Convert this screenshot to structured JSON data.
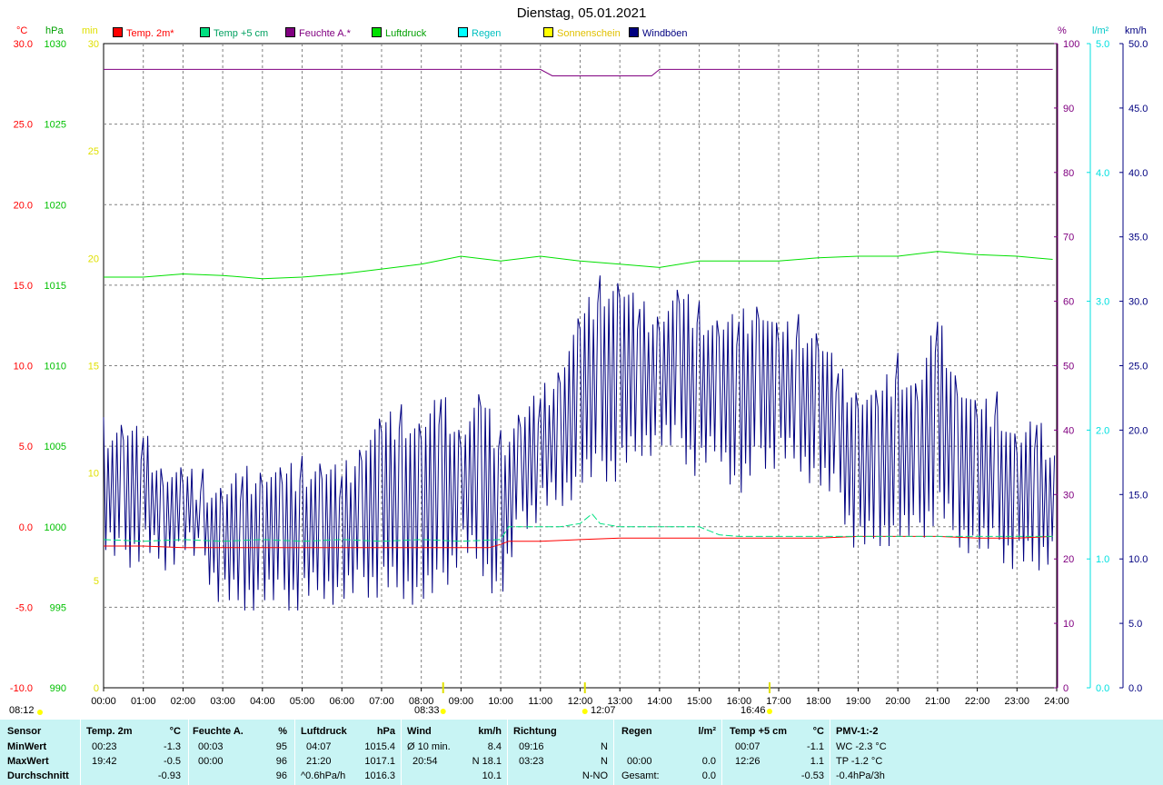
{
  "title": "Dienstag, 05.01.2021",
  "legend": [
    {
      "label": "Temp. 2m*",
      "color": "#ff0000",
      "text_color": "#ff0000"
    },
    {
      "label": "Temp +5 cm",
      "color": "#00e080",
      "text_color": "#00a060"
    },
    {
      "label": "Feuchte A.*",
      "color": "#800080",
      "text_color": "#800080"
    },
    {
      "label": "Luftdruck",
      "color": "#00e000",
      "text_color": "#00a000"
    },
    {
      "label": "Regen",
      "color": "#00ffff",
      "text_color": "#00c0c0"
    },
    {
      "label": "Sonnenschein",
      "color": "#ffff00",
      "text_color": "#e0c000"
    },
    {
      "label": "Windböen",
      "color": "#000080",
      "text_color": "#000080"
    }
  ],
  "units": {
    "temp": "°C",
    "pressure": "hPa",
    "sun": "min",
    "humidity": "%",
    "rain": "l/m²",
    "wind": "km/h"
  },
  "chart_data": {
    "type": "line",
    "x_ticks": [
      "00:00",
      "01:00",
      "02:00",
      "03:00",
      "04:00",
      "05:00",
      "06:00",
      "07:00",
      "08:00",
      "09:00",
      "10:00",
      "11:00",
      "12:00",
      "13:00",
      "14:00",
      "15:00",
      "16:00",
      "17:00",
      "18:00",
      "19:00",
      "20:00",
      "21:00",
      "22:00",
      "23:00",
      "24:00"
    ],
    "axes": {
      "temp": {
        "ticks": [
          "30.0",
          "25.0",
          "20.0",
          "15.0",
          "10.0",
          "5.0",
          "0.0",
          "-5.0",
          "-10.0"
        ],
        "range": [
          -10,
          30
        ],
        "color": "#ff0000"
      },
      "pressure": {
        "ticks": [
          "1030",
          "1025",
          "1020",
          "1015",
          "1010",
          "1005",
          "1000",
          "995",
          "990"
        ],
        "range": [
          990,
          1030
        ],
        "color": "#00c000"
      },
      "sun": {
        "ticks": [
          "30",
          "25",
          "20",
          "15",
          "10",
          "5",
          "0"
        ],
        "range": [
          0,
          30
        ],
        "color": "#e0e000"
      },
      "humidity": {
        "ticks": [
          "100",
          "90",
          "80",
          "70",
          "60",
          "50",
          "40",
          "30",
          "20",
          "10",
          "0"
        ],
        "range": [
          0,
          100
        ],
        "color": "#800080"
      },
      "rain": {
        "ticks": [
          "5.0",
          "4.0",
          "3.0",
          "2.0",
          "1.0",
          "0.0"
        ],
        "range": [
          0,
          5
        ],
        "color": "#00e0e0"
      },
      "wind": {
        "ticks": [
          "50.0",
          "45.0",
          "40.0",
          "35.0",
          "30.0",
          "25.0",
          "20.0",
          "15.0",
          "10.0",
          "5.0",
          "0.0"
        ],
        "range": [
          0,
          50
        ],
        "color": "#000080"
      }
    },
    "series": [
      {
        "name": "Temp. 2m*",
        "axis": "temp",
        "color": "#ff0000",
        "x": [
          0,
          1,
          2,
          3,
          4,
          5,
          6,
          7,
          8,
          9,
          9.7,
          10,
          10.2,
          11,
          12,
          13,
          14,
          15,
          16,
          17,
          18,
          19,
          20,
          21,
          22,
          23,
          23.9
        ],
        "y": [
          -1.2,
          -1.2,
          -1.3,
          -1.3,
          -1.3,
          -1.3,
          -1.3,
          -1.3,
          -1.3,
          -1.3,
          -1.3,
          -1.1,
          -0.9,
          -0.9,
          -0.8,
          -0.7,
          -0.7,
          -0.7,
          -0.7,
          -0.7,
          -0.7,
          -0.6,
          -0.6,
          -0.6,
          -0.7,
          -0.7,
          -0.6
        ]
      },
      {
        "name": "Temp +5 cm",
        "axis": "temp",
        "color": "#00e080",
        "x": [
          0,
          1,
          2,
          3,
          4,
          5,
          6,
          7,
          8,
          9,
          10,
          10.2,
          11,
          11.5,
          12,
          12.3,
          12.5,
          13,
          14,
          15,
          15.5,
          16,
          17,
          18,
          19,
          20,
          21,
          22,
          23,
          23.9
        ],
        "y": [
          -0.8,
          -0.9,
          -0.8,
          -0.9,
          -0.8,
          -0.9,
          -0.8,
          -0.9,
          -0.8,
          -0.9,
          -0.8,
          0.0,
          0.0,
          0.0,
          0.2,
          0.8,
          0.2,
          0.0,
          0.0,
          0.0,
          -0.5,
          -0.6,
          -0.6,
          -0.6,
          -0.6,
          -0.6,
          -0.6,
          -0.6,
          -0.6,
          -0.6
        ]
      },
      {
        "name": "Feuchte A.*",
        "axis": "humidity",
        "color": "#800080",
        "x": [
          0,
          0.2,
          1,
          2,
          4,
          6,
          8,
          10,
          11,
          11.3,
          12,
          13,
          13.8,
          14,
          14.5,
          15,
          15.5,
          16,
          18,
          20,
          22,
          23.9
        ],
        "y": [
          96,
          96,
          96,
          96,
          96,
          96,
          96,
          96,
          96,
          95,
          95,
          95,
          95,
          96,
          96,
          96,
          96,
          96,
          96,
          96,
          96,
          96
        ]
      },
      {
        "name": "Luftdruck",
        "axis": "pressure",
        "color": "#00e000",
        "x": [
          0,
          1,
          2,
          3,
          4,
          5,
          6,
          7,
          8,
          9,
          10,
          11,
          12,
          13,
          14,
          15,
          16,
          17,
          18,
          19,
          20,
          21,
          22,
          23,
          23.9
        ],
        "y": [
          1015.5,
          1015.5,
          1015.7,
          1015.6,
          1015.4,
          1015.5,
          1015.7,
          1016.0,
          1016.3,
          1016.8,
          1016.5,
          1016.8,
          1016.5,
          1016.3,
          1016.1,
          1016.5,
          1016.5,
          1016.5,
          1016.7,
          1016.8,
          1016.8,
          1017.1,
          1016.9,
          1016.8,
          1016.6
        ]
      },
      {
        "name": "Windböen",
        "axis": "wind",
        "color": "#000080",
        "x": [
          0,
          0.5,
          1,
          1.5,
          2,
          2.5,
          3,
          3.5,
          4,
          4.5,
          5,
          5.5,
          6,
          6.5,
          7,
          7.5,
          8,
          8.5,
          9,
          9.5,
          10,
          10.5,
          11,
          11.5,
          12,
          12.5,
          13,
          13.5,
          14,
          14.5,
          15,
          15.5,
          16,
          16.5,
          17,
          17.5,
          18,
          18.5,
          19,
          19.5,
          20,
          20.5,
          21,
          21.5,
          22,
          22.5,
          23,
          23.5,
          24
        ],
        "y": [
          16,
          12,
          15,
          11,
          13,
          12,
          9,
          11,
          10,
          12,
          10,
          11,
          10,
          12,
          13,
          14,
          15,
          16,
          15,
          14,
          13,
          17,
          20,
          22,
          22,
          25,
          26,
          25,
          24,
          25,
          23,
          24,
          22,
          25,
          23,
          24,
          21,
          20,
          16,
          17,
          17,
          18,
          20,
          17,
          16,
          17,
          15,
          16,
          16
        ],
        "min": [
          10,
          9,
          10,
          9,
          10,
          9,
          6,
          6,
          6,
          6,
          6,
          7,
          6,
          7,
          7,
          7,
          6,
          7,
          10,
          9,
          6,
          12,
          13,
          14,
          15,
          16,
          16,
          18,
          18,
          18,
          16,
          18,
          14,
          17,
          17,
          17,
          15,
          14,
          10,
          11,
          11,
          11,
          13,
          11,
          10,
          10,
          9,
          9,
          10
        ],
        "max": [
          21,
          21,
          20,
          18,
          17,
          17,
          16,
          17,
          18,
          17,
          18,
          18,
          17,
          20,
          21,
          22,
          21,
          23,
          21,
          23,
          20,
          22,
          23,
          26,
          29,
          32,
          32,
          30,
          30,
          31,
          30,
          29,
          29,
          31,
          28,
          29,
          28,
          25,
          24,
          23,
          26,
          24,
          29,
          25,
          22,
          23,
          20,
          21,
          19
        ]
      }
    ],
    "sun_markers": [
      {
        "label": "08:12",
        "pos": "bottom-left"
      },
      {
        "label": "08:33",
        "pos": "axis"
      },
      {
        "label": "12:07",
        "pos": "axis"
      },
      {
        "label": "16:46",
        "pos": "axis"
      }
    ]
  },
  "table": {
    "columns": [
      {
        "header": "Sensor",
        "unit": "",
        "rows": [
          "MinWert",
          "MaxWert",
          "Durchschnitt"
        ]
      },
      {
        "header": "Temp. 2m",
        "unit": "°C",
        "time": [
          "00:23",
          "19:42",
          ""
        ],
        "value": [
          "-1.3",
          "-0.5",
          "-0.93"
        ]
      },
      {
        "header": "Feuchte A.",
        "unit": "%",
        "time": [
          "00:03",
          "00:00",
          ""
        ],
        "value": [
          "95",
          "96",
          "96"
        ]
      },
      {
        "header": "Luftdruck",
        "unit": "hPa",
        "time": [
          "04:07",
          "21:20",
          "^0.6hPa/h"
        ],
        "value": [
          "1015.4",
          "1017.1",
          "1016.3"
        ]
      },
      {
        "header": "Wind",
        "unit": "km/h",
        "time": [
          "Ø 10 min.",
          "20:54",
          ""
        ],
        "value": [
          "8.4",
          "N 18.1",
          "10.1"
        ]
      },
      {
        "header": "Richtung",
        "unit": "",
        "time": [
          "09:16",
          "03:23",
          ""
        ],
        "value": [
          "N",
          "N",
          "N-NO"
        ]
      },
      {
        "header": "Regen",
        "unit": "l/m²",
        "time": [
          "",
          "00:00",
          "Gesamt:"
        ],
        "value": [
          "",
          "0.0",
          "0.0"
        ]
      },
      {
        "header": "Temp +5 cm",
        "unit": "°C",
        "time": [
          "00:07",
          "12:26",
          ""
        ],
        "value": [
          "-1.1",
          "1.1",
          "-0.53"
        ]
      },
      {
        "header": "PMV-1:-2",
        "unit": "",
        "time": [
          "WC -2.3 °C",
          "TP -1.2 °C",
          "-0.4hPa/3h"
        ],
        "value": [
          "",
          "",
          ""
        ]
      }
    ]
  }
}
